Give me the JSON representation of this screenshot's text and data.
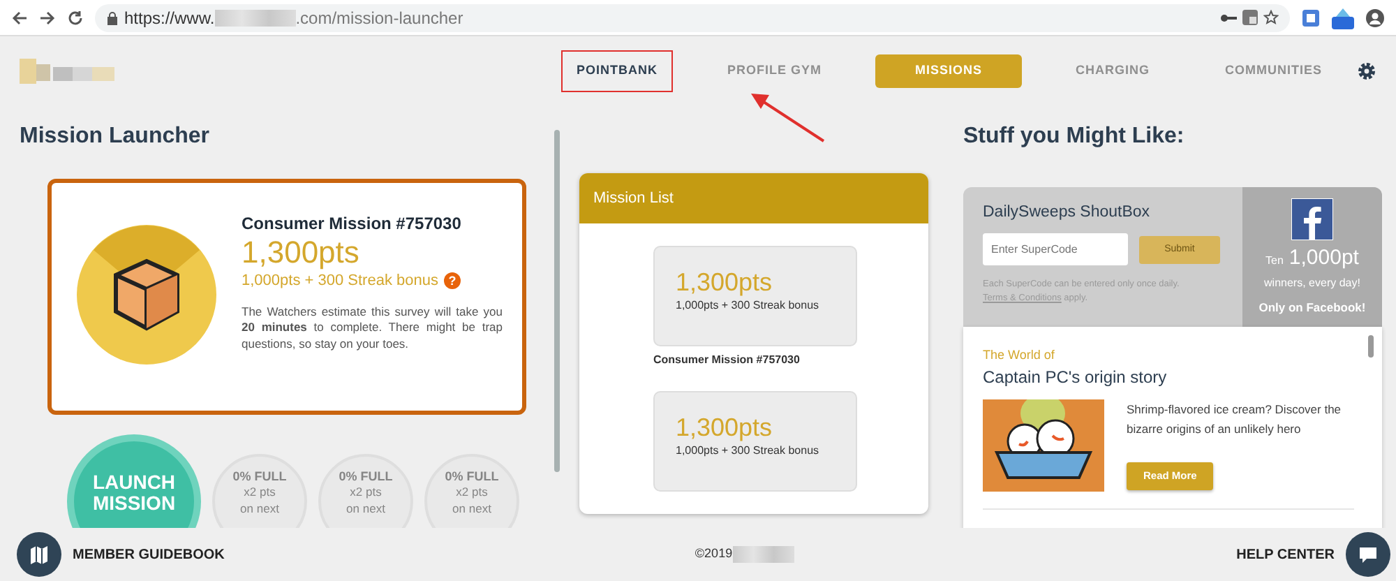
{
  "browser": {
    "url_prefix": "https://www.",
    "url_suffix": ".com/mission-launcher"
  },
  "nav": {
    "tabs": [
      {
        "label": "POINTBANK",
        "selected": false,
        "annotated": true
      },
      {
        "label": "PROFILE GYM",
        "selected": false,
        "annotated": false
      },
      {
        "label": "MISSIONS",
        "selected": true,
        "annotated": false
      },
      {
        "label": "CHARGING",
        "selected": false,
        "annotated": false
      },
      {
        "label": "COMMUNITIES",
        "selected": false,
        "annotated": false
      }
    ]
  },
  "launcher": {
    "title": "Mission Launcher",
    "mission": {
      "name": "Consumer Mission #757030",
      "points": "1,300pts",
      "breakdown": "1,000pts + 300 Streak bonus",
      "help": "?",
      "description": "The Watchers estimate this survey will take you **20 minutes** to complete. There might be trap questions, so stay on your toes."
    },
    "launch_button": "LAUNCH MISSION",
    "boosters": [
      {
        "lines": [
          "0% FULL",
          "x2 pts",
          "on next"
        ]
      },
      {
        "lines": [
          "0% FULL",
          "x2 pts",
          "on next"
        ]
      },
      {
        "lines": [
          "0% FULL",
          "x2 pts",
          "on next"
        ]
      }
    ]
  },
  "mission_list": {
    "title": "Mission List",
    "items": [
      {
        "points": "1,300pts",
        "breakdown": "1,000pts + 300 Streak bonus",
        "name": "Consumer Mission #757030"
      },
      {
        "points": "1,300pts",
        "breakdown": "1,000pts + 300 Streak bonus"
      }
    ]
  },
  "suggestions": {
    "title": "Stuff you Might Like:",
    "shoutbox": {
      "title": "DailySweeps ShoutBox",
      "placeholder": "Enter SuperCode",
      "submit": "Submit",
      "note": "Each SuperCode can be entered only once daily.",
      "terms_link": "Terms & Conditions",
      "terms_suffix": "apply."
    },
    "facebook": {
      "prefix": "Ten",
      "amount": "1,000pt",
      "line": "winners, every day!",
      "cta": "Only on Facebook!"
    },
    "article": {
      "kicker": "The World of",
      "title": "Captain PC's origin story",
      "text": "Shrimp-flavored ice cream? Discover the bizarre origins of an unlikely hero",
      "button": "Read More"
    }
  },
  "footer": {
    "guidebook": "MEMBER GUIDEBOOK",
    "copyright": "©2019",
    "help": "HELP CENTER"
  }
}
